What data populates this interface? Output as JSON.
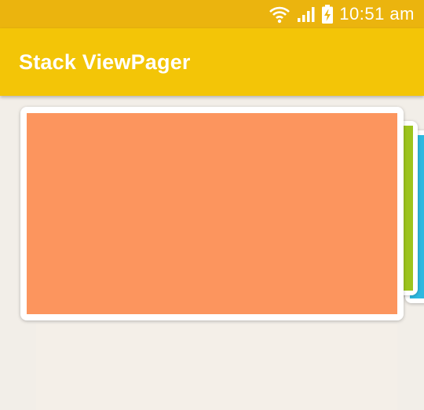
{
  "status_bar": {
    "time": "10:51 am",
    "icons": [
      "wifi-icon",
      "signal-icon",
      "battery-charging-icon"
    ]
  },
  "app_bar": {
    "title": "Stack ViewPager"
  },
  "stack": {
    "cards": [
      {
        "color": "#fc955e"
      },
      {
        "color": "#9cc41e"
      },
      {
        "color": "#2eb9e0"
      }
    ]
  }
}
